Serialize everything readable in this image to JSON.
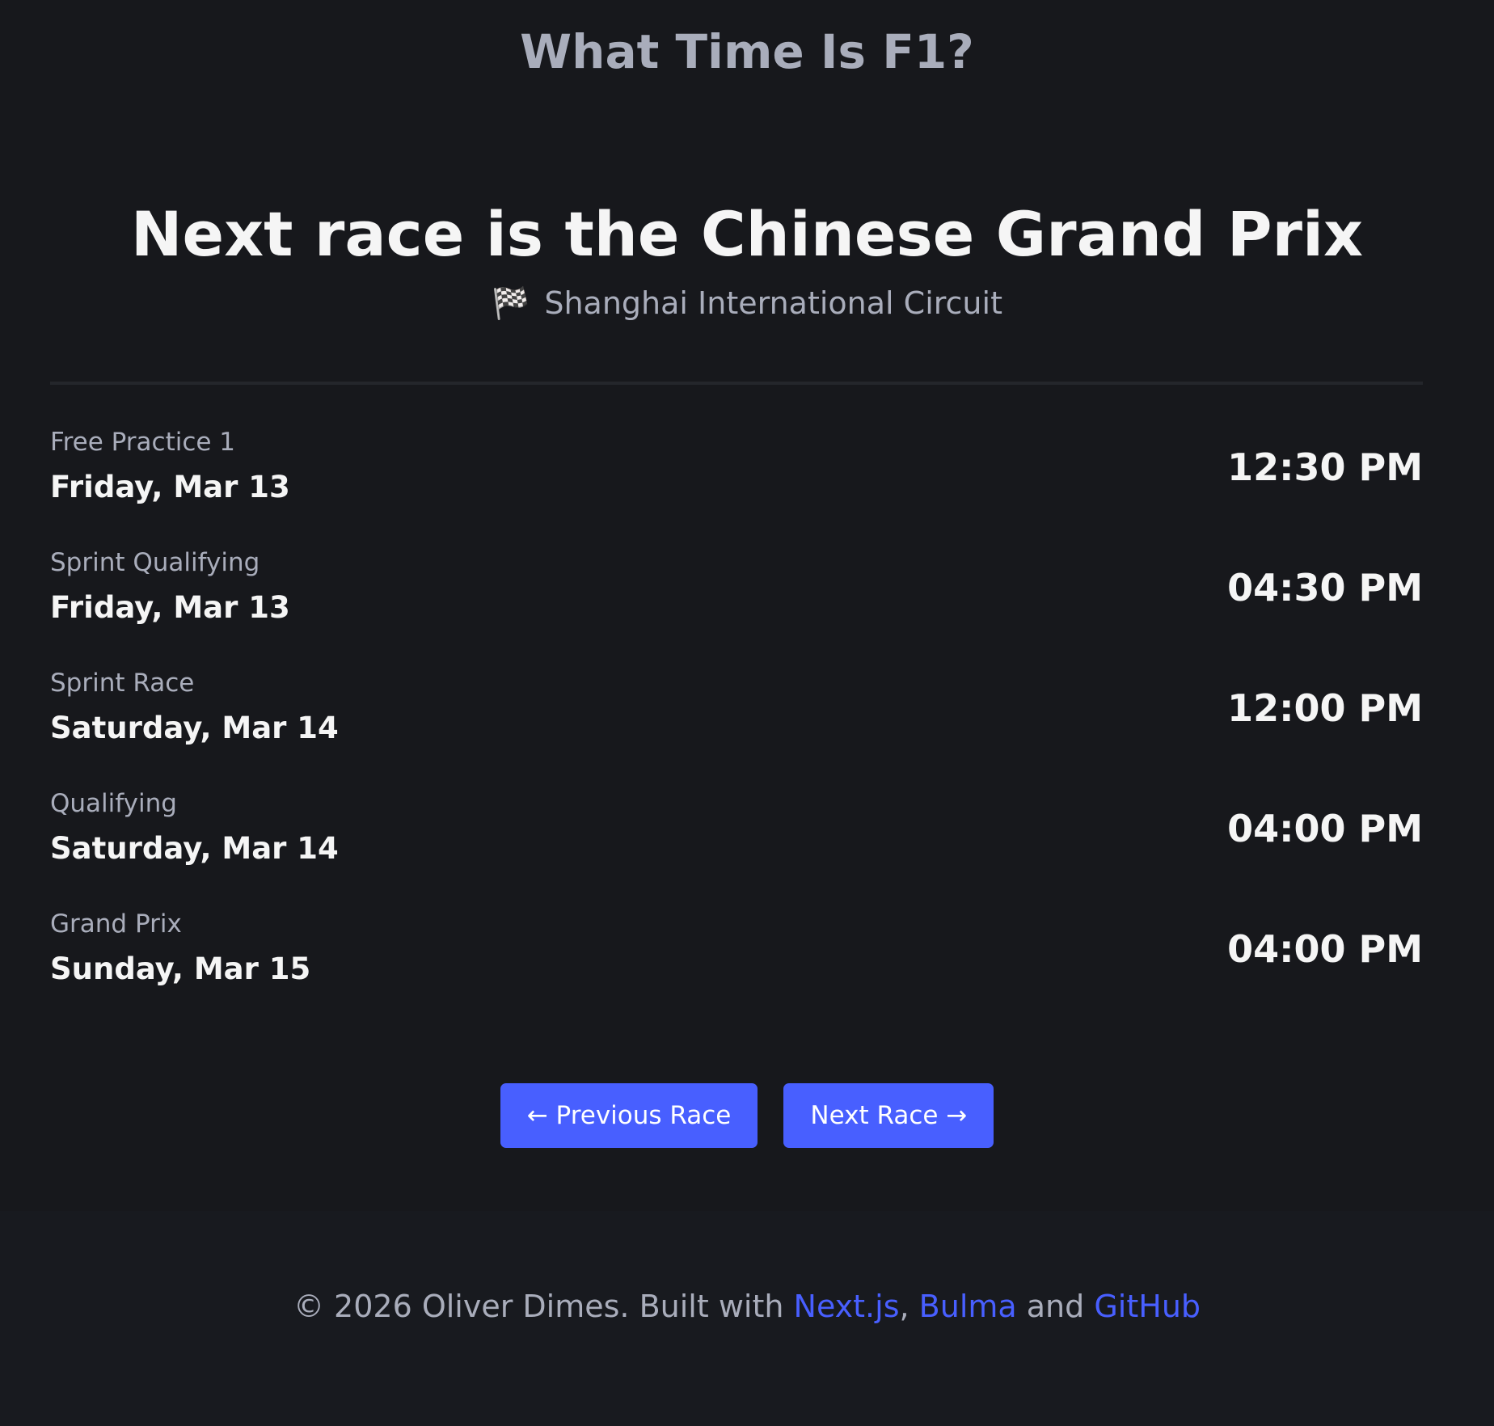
{
  "header": {
    "site_title": "What Time Is F1?"
  },
  "hero": {
    "heading": "Next race is the Chinese Grand Prix",
    "flag_icon": "🏁",
    "circuit": "Shanghai International Circuit"
  },
  "sessions": [
    {
      "name": "Free Practice 1",
      "date": "Friday, Mar 13",
      "time": "12:30 PM"
    },
    {
      "name": "Sprint Qualifying",
      "date": "Friday, Mar 13",
      "time": "04:30 PM"
    },
    {
      "name": "Sprint Race",
      "date": "Saturday, Mar 14",
      "time": "12:00 PM"
    },
    {
      "name": "Qualifying",
      "date": "Saturday, Mar 14",
      "time": "04:00 PM"
    },
    {
      "name": "Grand Prix",
      "date": "Sunday, Mar 15",
      "time": "04:00 PM"
    }
  ],
  "navigation": {
    "previous_label": "← Previous Race",
    "next_label": "Next Race →"
  },
  "footer": {
    "prefix": "© 2026 Oliver Dimes. Built with ",
    "link_nextjs": "Next.js",
    "sep_comma": ", ",
    "link_bulma": "Bulma",
    "sep_and": " and ",
    "link_github": "GitHub"
  },
  "colors": {
    "background": "#17181c",
    "footer_background": "#181a1f",
    "accent": "#485fff",
    "muted_text": "#a9adbb",
    "primary_text": "#f5f5f5"
  }
}
